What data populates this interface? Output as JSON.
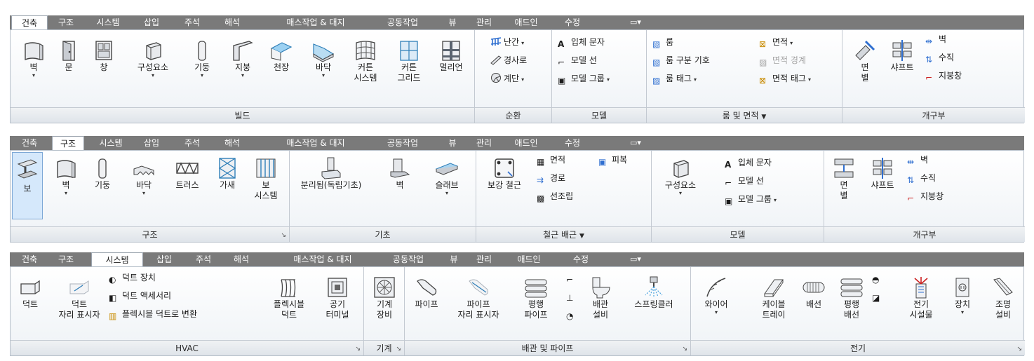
{
  "tabs": [
    "건축",
    "구조",
    "시스템",
    "삽입",
    "주석",
    "해석",
    "매스작업 & 대지",
    "공동작업",
    "뷰",
    "관리",
    "애드인",
    "수정"
  ],
  "context_tab_icon": "camera-icon",
  "ribbon1": {
    "active_tab": "건축",
    "build": {
      "title": "빌드",
      "wall": "벽",
      "door": "문",
      "window": "창",
      "component": "구성요소",
      "column": "기둥",
      "roof": "지붕",
      "ceiling": "천장",
      "floor": "바닥",
      "curtain_system_1": "커튼",
      "curtain_system_2": "시스템",
      "curtain_grid_1": "커튼",
      "curtain_grid_2": "그리드",
      "mullion": "멀리언"
    },
    "circulation": {
      "title": "순환",
      "railing": "난간",
      "ramp": "경사로",
      "stair": "계단"
    },
    "model": {
      "title": "모델",
      "text": "입체 문자",
      "line": "모델 선",
      "group": "모델 그룹"
    },
    "room_area": {
      "title": "룸 및 면적",
      "room": "룸",
      "room_separator": "룸 구분 기호",
      "room_tag": "룸 태그",
      "area": "면적",
      "area_boundary": "면적 경계",
      "area_tag": "면적 태그"
    },
    "opening": {
      "title": "개구부",
      "by_face_1": "면",
      "by_face_2": "별",
      "shaft": "샤프트",
      "wall": "벽",
      "vertical": "수직",
      "dormer": "지붕창"
    }
  },
  "ribbon2": {
    "active_tab": "구조",
    "structure": {
      "title": "구조",
      "beam": "보",
      "wall": "벽",
      "column": "기둥",
      "floor": "바닥",
      "truss": "트러스",
      "brace": "가새",
      "beam_system_1": "보",
      "beam_system_2": "시스템"
    },
    "foundation": {
      "title": "기초",
      "isolated": "분리됨(독립기초)",
      "wall": "벽",
      "slab": "슬래브"
    },
    "rebar": {
      "title": "철근 배근",
      "rebar": "보강 철근",
      "area": "면적",
      "path": "경로",
      "fabric": "선조립",
      "cover": "피복"
    },
    "model": {
      "title": "모델",
      "component": "구성요소",
      "text": "입체 문자",
      "line": "모델 선",
      "group": "모델 그룹"
    },
    "opening": {
      "title": "개구부",
      "by_face_1": "면",
      "by_face_2": "별",
      "shaft": "샤프트",
      "wall": "벽",
      "vertical": "수직",
      "dormer": "지붕창"
    }
  },
  "ribbon3": {
    "active_tab": "시스템",
    "hvac": {
      "title": "HVAC",
      "duct": "덕트",
      "duct_placeholder_1": "덕트",
      "duct_placeholder_2": "자리 표시자",
      "duct_fitting": "덕트 장치",
      "duct_accessory": "덕트 액세서리",
      "convert_flex": "플렉시블 덕트로 변환",
      "flex_duct_1": "플렉시블",
      "flex_duct_2": "덕트",
      "air_terminal_1": "공기",
      "air_terminal_2": "터미널"
    },
    "mechanical": {
      "title": "기계",
      "equipment_1": "기계",
      "equipment_2": "장비"
    },
    "plumbing": {
      "title": "배관 및 파이프",
      "pipe": "파이프",
      "pipe_placeholder_1": "파이프",
      "pipe_placeholder_2": "자리 표시자",
      "parallel_1": "평행",
      "parallel_2": "파이프",
      "fixture_1": "배관",
      "fixture_2": "설비",
      "sprinkler": "스프링클러"
    },
    "electrical": {
      "title": "전기",
      "wire": "와이어",
      "cable_tray_1": "케이블",
      "cable_tray_2": "트레이",
      "conduit": "배선",
      "parallel_1": "평행",
      "parallel_2": "배선",
      "equipment_1": "전기",
      "equipment_2": "시설물",
      "device": "장치",
      "lighting_1": "조명",
      "lighting_2": "설비"
    }
  }
}
